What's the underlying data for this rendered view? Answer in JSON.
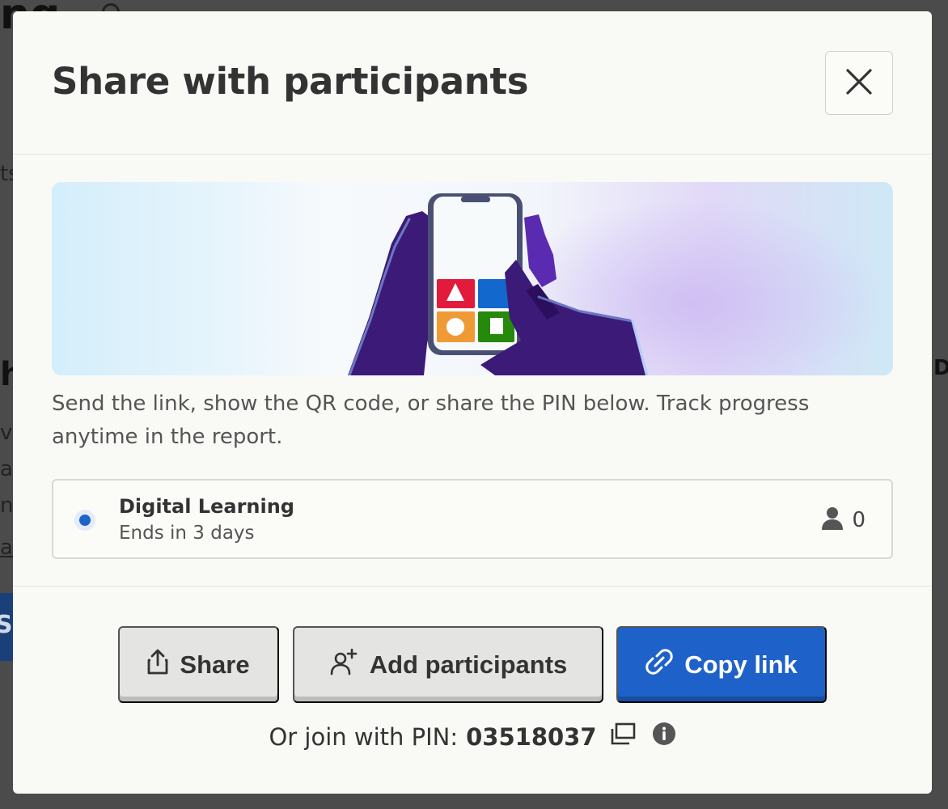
{
  "modal": {
    "title": "Share with participants",
    "description": "Send the link, show the QR code, or share the PIN below. Track progress anytime in the report.",
    "close_icon": "close-icon",
    "hero_illustration": "phone-in-hands-illustration"
  },
  "session": {
    "name": "Digital Learning",
    "ends": "Ends in 3 days",
    "participant_count": "0",
    "status_color": "#1e64c8",
    "participants_icon": "person-icon"
  },
  "actions": {
    "share_label": "Share",
    "share_icon": "share-upload-icon",
    "add_participants_label": "Add participants",
    "add_participants_icon": "add-person-icon",
    "copy_link_label": "Copy link",
    "copy_link_icon": "link-icon",
    "accent_color": "#1e62c9"
  },
  "pin": {
    "prefix": "Or join with PIN:",
    "value": "03518037",
    "copy_icon": "copy-icon",
    "info_icon": "info-icon"
  },
  "background_fragments": {
    "top_left": "ng",
    "mid_left": "ts",
    "heading_left": "h",
    "row1": "v",
    "row2": "ar",
    "row3": "nt",
    "row4": "a",
    "button_left": "S",
    "right_edge": "D"
  }
}
